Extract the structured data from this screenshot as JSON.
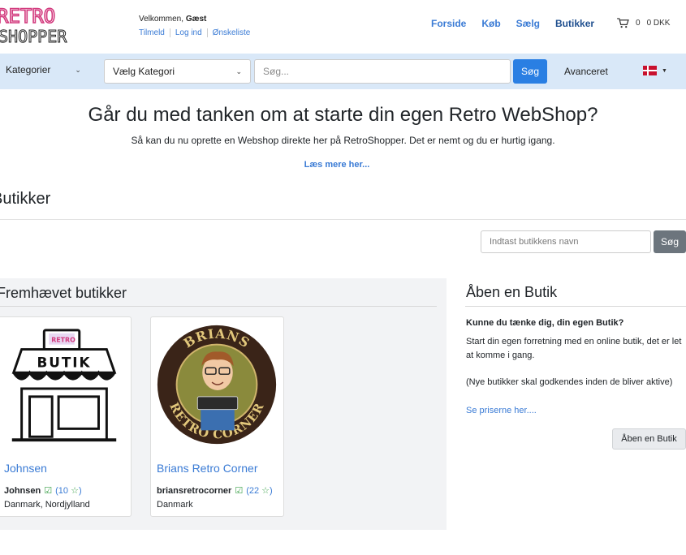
{
  "logo": {
    "line1": "RETRO",
    "line2": "SHOPPER"
  },
  "header": {
    "welcome_prefix": "Velkommen,",
    "welcome_user": "Gæst",
    "user_links": [
      "Tilmeld",
      "Log ind",
      "Ønskeliste"
    ],
    "nav": [
      "Forside",
      "Køb",
      "Sælg",
      "Butikker"
    ],
    "cart_count": "0",
    "cart_total": "0 DKK"
  },
  "searchbar": {
    "categories_label": "Kategorier",
    "select_value": "Vælg Kategori",
    "search_placeholder": "Søg...",
    "search_button": "Søg",
    "advanced": "Avanceret"
  },
  "promo": {
    "title": "Går du med tanken om at starte din egen Retro WebShop?",
    "subtitle": "Så kan du nu oprette en Webshop direkte her på RetroShopper. Det er nemt og du er hurtig igang.",
    "link": "Læs mere her..."
  },
  "page_heading": "Butikker",
  "shop_search": {
    "placeholder": "Indtast butikkens navn",
    "button": "Søg"
  },
  "featured": {
    "title": "Fremhævet butikker",
    "shops": [
      {
        "name": "Johnsen",
        "owner": "Johnsen",
        "rating_open": "(10",
        "rating_close": ")",
        "location": "Danmark, Nordjylland",
        "logo_text": "BUTIK"
      },
      {
        "name": "Brians Retro Corner",
        "owner": "briansretrocorner",
        "rating_open": "(22",
        "rating_close": ")",
        "location": "Danmark",
        "logo_top": "BRIANS",
        "logo_bottom": "RETRO CORNER"
      }
    ]
  },
  "open_shop": {
    "title": "Åben en Butik",
    "question": "Kunne du tænke dig, din egen Butik?",
    "text": "Start din egen forretning med en online butik, det er let at komme i gang.",
    "note": "(Nye butikker skal godkendes inden de bliver aktive)",
    "link": "Se priserne her....",
    "button": "Åben en Butik"
  }
}
